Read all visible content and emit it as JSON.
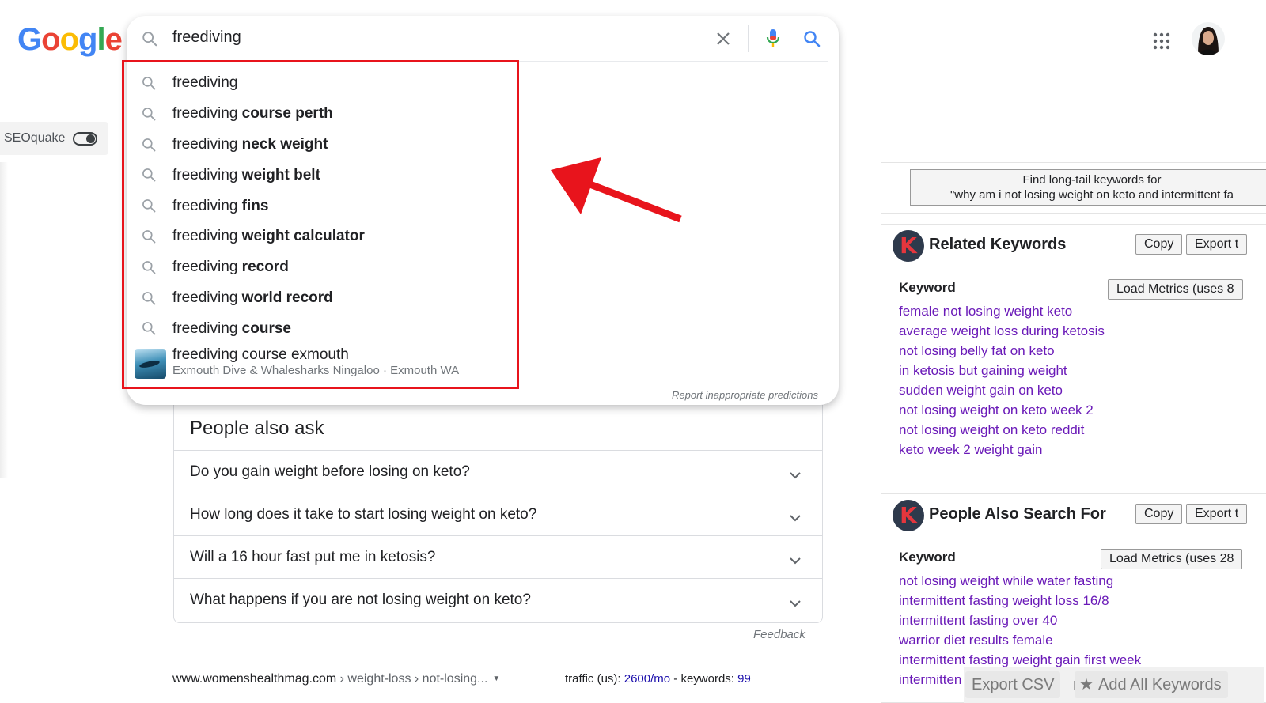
{
  "logo": {
    "letters": [
      "G",
      "o",
      "o",
      "g",
      "l",
      "e"
    ],
    "colors": [
      "#4285f4",
      "#ea4335",
      "#fbbc05",
      "#4285f4",
      "#34a853",
      "#ea4335"
    ]
  },
  "search": {
    "value": "freediving"
  },
  "suggestions": [
    {
      "prefix": "freediving",
      "bold": ""
    },
    {
      "prefix": "freediving ",
      "bold": "course perth"
    },
    {
      "prefix": "freediving ",
      "bold": "neck weight"
    },
    {
      "prefix": "freediving ",
      "bold": "weight belt"
    },
    {
      "prefix": "freediving ",
      "bold": "fins"
    },
    {
      "prefix": "freediving ",
      "bold": "weight calculator"
    },
    {
      "prefix": "freediving ",
      "bold": "record"
    },
    {
      "prefix": "freediving ",
      "bold": "world record"
    },
    {
      "prefix": "freediving ",
      "bold": "course"
    }
  ],
  "rich_suggestion": {
    "title": "freediving course exmouth",
    "subtitle": "Exmouth Dive & Whalesharks Ningaloo · Exmouth WA"
  },
  "report_link": "Report inappropriate predictions",
  "seoquake": {
    "label": "SEOquake"
  },
  "paa": {
    "title": "People also ask",
    "questions": [
      "Do you gain weight before losing on keto?",
      "How long does it take to start losing weight on keto?",
      "Will a 16 hour fast put me in ketosis?",
      "What happens if you are not losing weight on keto?"
    ],
    "feedback": "Feedback"
  },
  "result": {
    "site": "www.womenshealthmag.com",
    "crumbs": " › weight-loss › not-losing...",
    "traffic_label": "traffic (us): ",
    "traffic_value": "2600/mo",
    "keywords_label": " - keywords: ",
    "keywords_value": "99"
  },
  "longtail": {
    "line1": "Find long-tail keywords for",
    "line2": "\"why am i not losing weight on keto and intermittent fa"
  },
  "related": {
    "title": "Related Keywords",
    "copy": "Copy",
    "export": "Export t",
    "keyword_header": "Keyword",
    "load_metrics": "Load Metrics (uses 8",
    "items": [
      "female not losing weight keto",
      "average weight loss during ketosis",
      "not losing belly fat on keto",
      "in ketosis but gaining weight",
      "sudden weight gain on keto",
      "not losing weight on keto week 2",
      "not losing weight on keto reddit",
      "keto week 2 weight gain"
    ]
  },
  "pasf": {
    "title": "People Also Search For",
    "copy": "Copy",
    "export": "Export t",
    "keyword_header": "Keyword",
    "load_metrics": "Load Metrics (uses 28",
    "items": [
      "not losing weight while water fasting",
      "intermittent fasting weight loss 16/8",
      "intermittent fasting over 40",
      "warrior diet results female",
      "intermittent fasting weight gain first week",
      "intermitten"
    ]
  },
  "bottom_bar": {
    "export_csv": "Export CSV",
    "add_all": "Add All Keywords"
  },
  "colors": {
    "highlight_red": "#e8141c",
    "link_purple": "#6a1ab8",
    "link_blue": "#1a0dab"
  }
}
